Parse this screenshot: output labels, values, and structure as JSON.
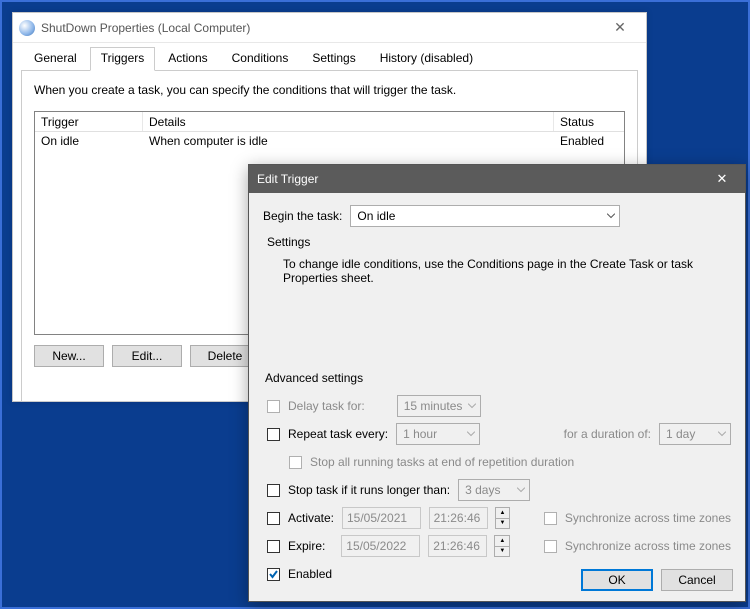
{
  "prop": {
    "title": "ShutDown Properties (Local Computer)",
    "tabs": {
      "general": "General",
      "triggers": "Triggers",
      "actions": "Actions",
      "conditions": "Conditions",
      "settings": "Settings",
      "history": "History (disabled)"
    },
    "intro": "When you create a task, you can specify the conditions that will trigger the task.",
    "columns": {
      "trigger": "Trigger",
      "details": "Details",
      "status": "Status"
    },
    "row": {
      "trigger": "On idle",
      "details": "When computer is idle",
      "status": "Enabled"
    },
    "buttons": {
      "new": "New...",
      "edit": "Edit...",
      "delete": "Delete"
    }
  },
  "dlg": {
    "title": "Edit Trigger",
    "begin_label": "Begin the task:",
    "begin_value": "On idle",
    "settings_label": "Settings",
    "settings_text": "To change idle conditions, use the Conditions page in the Create Task or task Properties sheet.",
    "adv_label": "Advanced settings",
    "delay_label": "Delay task for:",
    "delay_value": "15 minutes",
    "repeat_label": "Repeat task every:",
    "repeat_value": "1 hour",
    "duration_label": "for a duration of:",
    "duration_value": "1 day",
    "stop_rep_label": "Stop all running tasks at end of repetition duration",
    "stop_longer_label": "Stop task if it runs longer than:",
    "stop_longer_value": "3 days",
    "activate_label": "Activate:",
    "activate_date": "15/05/2021",
    "activate_time": "21:26:46",
    "expire_label": "Expire:",
    "expire_date": "15/05/2022",
    "expire_time": "21:26:46",
    "sync_label": "Synchronize across time zones",
    "enabled_label": "Enabled",
    "ok": "OK",
    "cancel": "Cancel"
  }
}
